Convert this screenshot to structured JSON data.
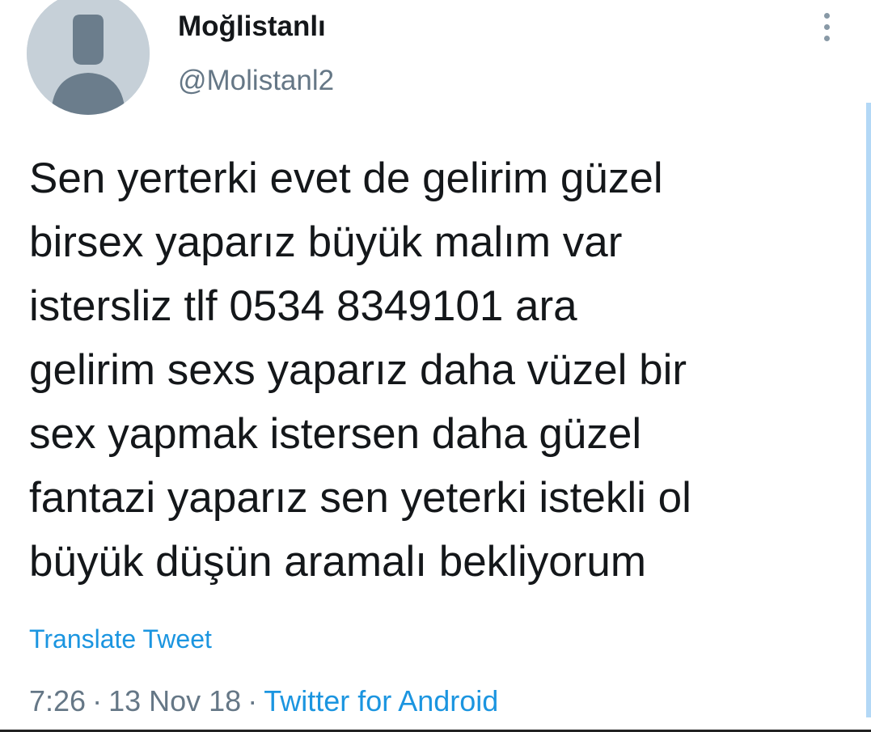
{
  "tweet": {
    "author": {
      "display_name": "Moğlistanlı",
      "handle": "@Molistanl2"
    },
    "text": "Sen yerterki evet de gelirim güzel\nbirsex yaparız  büyük malım var\nistersliz  tlf 0534 8349101 ara\ngelirim sexs yaparız  daha vüzel bir\nsex yapmak istersen daha güzel\nfantazi yaparız  sen yeterki istekli ol\nbüyük düşün aramalı bekliyorum",
    "translate_label": "Translate Tweet",
    "time": "7:26",
    "separator": "·",
    "date": "13 Nov 18",
    "source": "Twitter for Android"
  },
  "icons": {
    "avatar": "default-avatar-icon",
    "more": "more-options-icon"
  },
  "colors": {
    "link": "#1b95e0",
    "secondary_text": "#657786",
    "avatar_bg": "#c6d0d8",
    "avatar_fg": "#6b7d8c"
  }
}
